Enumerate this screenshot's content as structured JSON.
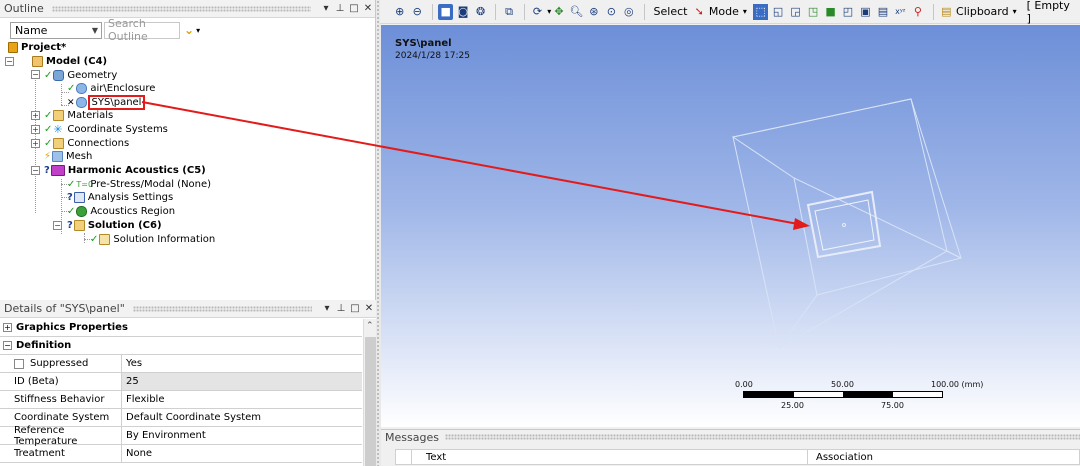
{
  "outline": {
    "title": "Outline",
    "filter_value": "Name",
    "search_placeholder": "Search Outline",
    "tree": {
      "project": "Project*",
      "model": "Model (C4)",
      "geometry": "Geometry",
      "air": "air\\Enclosure",
      "panel": "SYS\\panel",
      "materials": "Materials",
      "coords": "Coordinate Systems",
      "connections": "Connections",
      "mesh": "Mesh",
      "harmonic": "Harmonic Acoustics (C5)",
      "prestress": "Pre-Stress/Modal (None)",
      "analysis": "Analysis Settings",
      "region": "Acoustics Region",
      "solution": "Solution (C6)",
      "solinfo": "Solution Information"
    }
  },
  "details": {
    "title": "Details of \"SYS\\panel\"",
    "groups": {
      "graphics": "Graphics Properties",
      "definition": "Definition"
    },
    "rows": [
      {
        "key": "Suppressed",
        "value": "Yes"
      },
      {
        "key": "ID (Beta)",
        "value": "25"
      },
      {
        "key": "Stiffness Behavior",
        "value": "Flexible"
      },
      {
        "key": "Coordinate System",
        "value": "Default Coordinate System"
      },
      {
        "key": "Reference Temperature",
        "value": "By Environment"
      },
      {
        "key": "Treatment",
        "value": "None"
      }
    ]
  },
  "toolbar": {
    "select_label": "Select",
    "mode_label": "Mode",
    "clipboard_label": "Clipboard",
    "empty_label": "[ Empty ]"
  },
  "viewport": {
    "title": "SYS\\panel",
    "date": "2024/1/28 17:25",
    "scale": {
      "top": [
        "0.00",
        "50.00",
        "100.00 (mm)"
      ],
      "bottom": [
        "25.00",
        "75.00"
      ]
    }
  },
  "messages": {
    "title": "Messages",
    "col_text": "Text",
    "col_assoc": "Association"
  },
  "colors": {
    "highlight": "#e21b1b",
    "check": "#1e9c1e",
    "question": "#1b3c8f"
  }
}
